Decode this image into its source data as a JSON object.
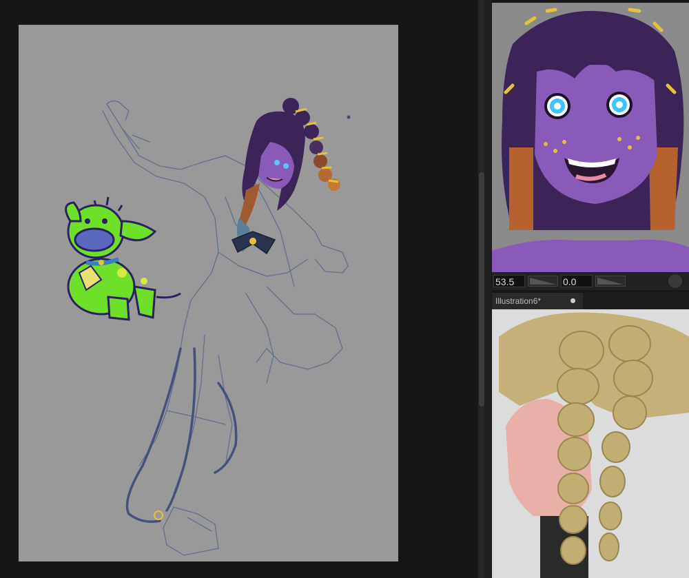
{
  "reference_panel": {
    "size_value": "53.5",
    "angle_value": "0.0"
  },
  "document_tab": {
    "title": "Illustration6*"
  },
  "colors": {
    "canvas_gray": "#999999",
    "sketch_line": "#5a6a8a",
    "skin_purple": "#8a5ab8",
    "hair_dark": "#3c2458",
    "cow_green": "#6ee02a"
  }
}
